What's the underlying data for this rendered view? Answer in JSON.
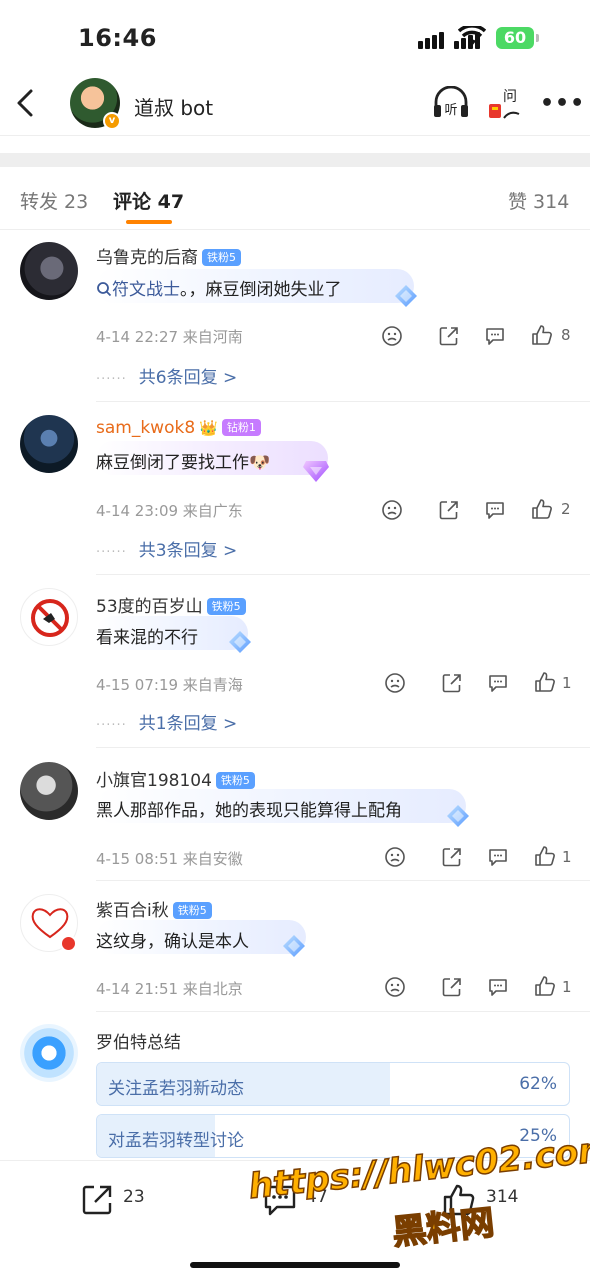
{
  "status_bar": {
    "time": "16:46",
    "battery": "60"
  },
  "header": {
    "account_name": "道叔 bot",
    "listen_label": "听",
    "ask_label": "问"
  },
  "tabs": [
    {
      "label": "转发 23"
    },
    {
      "label": "评论 47"
    },
    {
      "label": "赞 314"
    }
  ],
  "comments": [
    {
      "user": "乌鲁克的后裔",
      "badge": "铁粉5",
      "topic": "符文战士",
      "text": "。，麻豆倒闭她失业了",
      "meta": "4-14 22:27 来自河南",
      "likes": "8",
      "replies": "共6条回复 >"
    },
    {
      "user": "sam_kwok8",
      "badge": "钻粉1",
      "text": "麻豆倒闭了要找工作",
      "emoji": "🐶",
      "meta": "4-14 23:09 来自广东",
      "likes": "2",
      "replies": "共3条回复 >"
    },
    {
      "user": "53度的百岁山",
      "badge": "铁粉5",
      "text": "看来混的不行",
      "meta": "4-15 07:19 来自青海",
      "likes": "1",
      "replies": "共1条回复 >"
    },
    {
      "user": "小旗官198104",
      "badge": "铁粉5",
      "text": "黑人那部作品，她的表现只能算得上配角",
      "meta": "4-15 08:51 来自安徽",
      "likes": "1"
    },
    {
      "user": "紫百合i秋",
      "badge": "铁粉5",
      "text": "这纹身，确认是本人",
      "meta": "4-14 21:51 来自北京",
      "likes": "1"
    }
  ],
  "robot_summary": {
    "title": "罗伯特总结",
    "options": [
      {
        "label": "关注孟若羽新动态",
        "percent": "62%",
        "value": 62
      },
      {
        "label": "对孟若羽转型讨论",
        "percent": "25%",
        "value": 25
      }
    ]
  },
  "bottom_bar": {
    "reposts": "23",
    "comments": "47",
    "likes": "314"
  },
  "watermark": {
    "line1": "https://hlwc02.com",
    "line2": "黑料网"
  },
  "colors": {
    "accent": "#ff8200",
    "link": "#4a6ea8",
    "battery": "#4cd964"
  }
}
